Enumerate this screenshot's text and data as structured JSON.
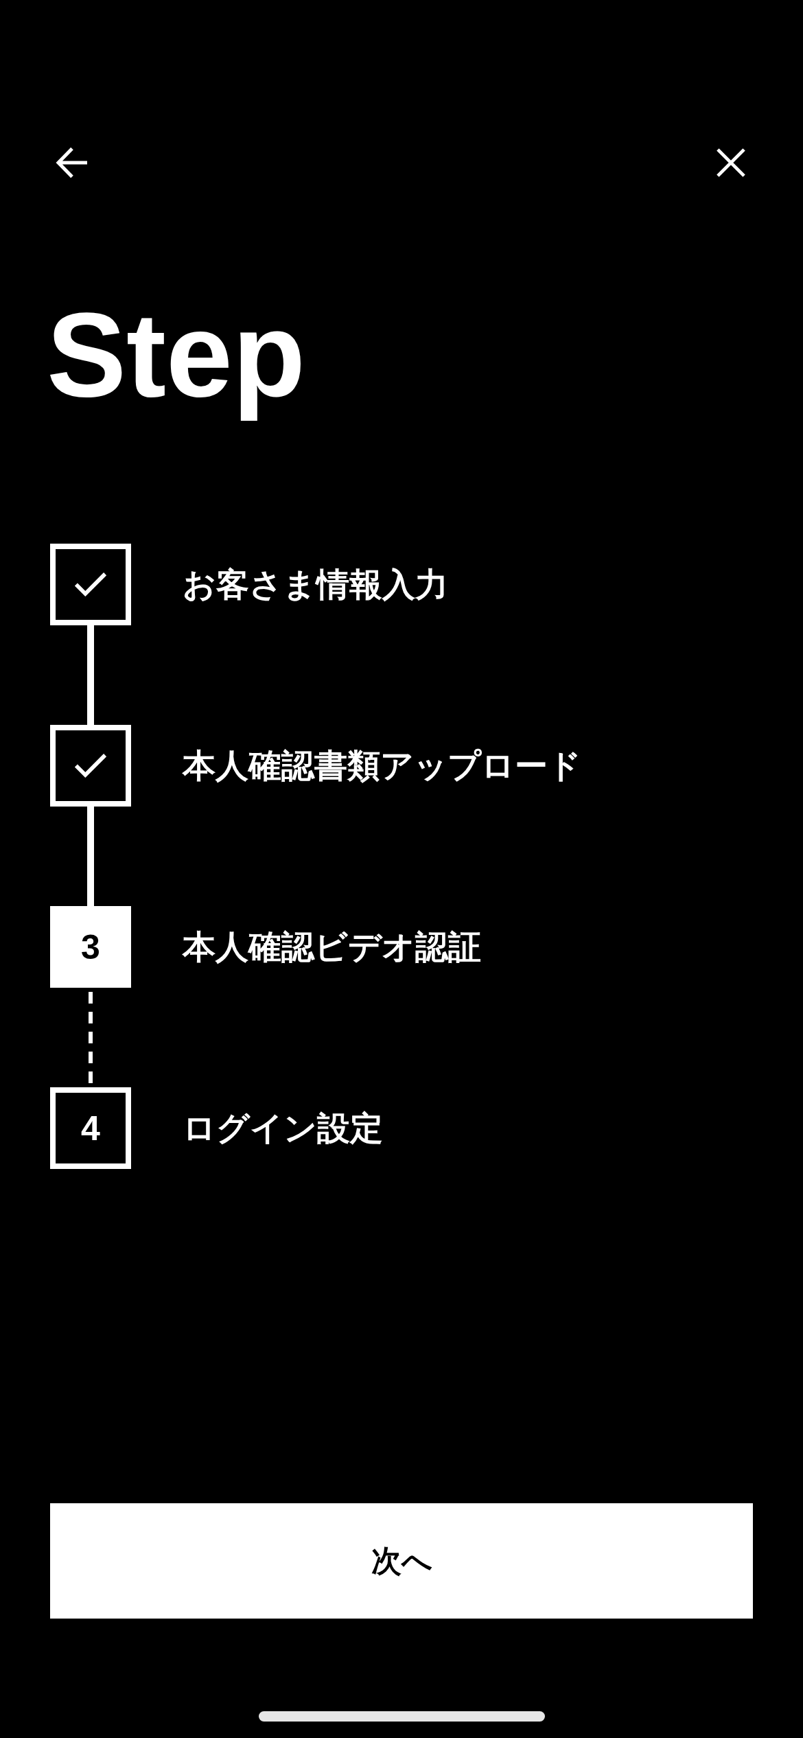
{
  "title": "Step",
  "steps": [
    {
      "completed": true,
      "current": false,
      "label": "お客さま情報入力"
    },
    {
      "completed": true,
      "current": false,
      "label": "本人確認書類アップロード"
    },
    {
      "completed": false,
      "current": true,
      "number": "3",
      "label": "本人確認ビデオ認証"
    },
    {
      "completed": false,
      "current": false,
      "number": "4",
      "label": "ログイン設定"
    }
  ],
  "next_button": {
    "label": "次へ"
  }
}
